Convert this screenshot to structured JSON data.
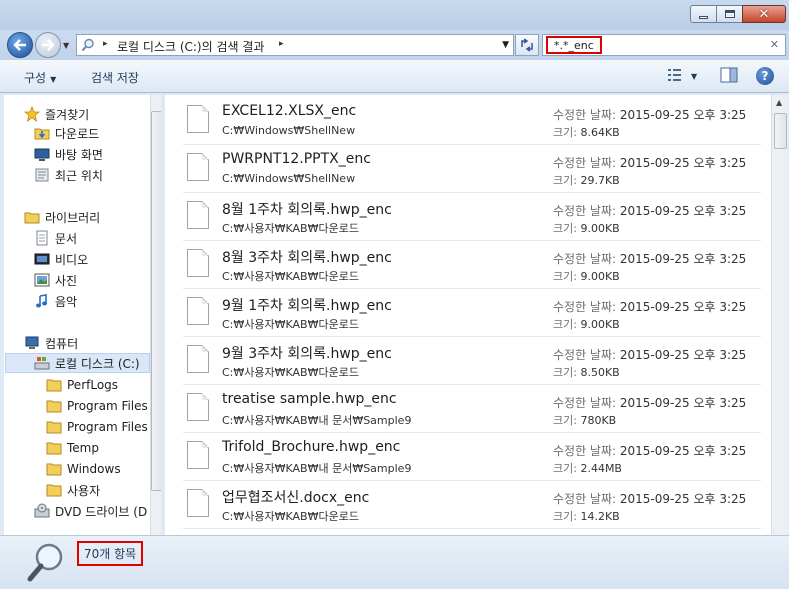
{
  "window": {
    "minimize_label": "minimize",
    "maximize_label": "maximize",
    "close_glyph": "✕"
  },
  "address_bar": {
    "breadcrumb_root_arrow": "▸",
    "location": "로컬 디스크 (C:)의 검색 결과",
    "trailing_arrow": "▸"
  },
  "search": {
    "query": "*.*_enc",
    "clear_glyph": "✕"
  },
  "toolbar": {
    "organize_label": "구성",
    "save_search_label": "검색 저장"
  },
  "nav": {
    "favorites": {
      "label": "즐겨찾기",
      "items": [
        {
          "label": "다운로드",
          "icon": "downloads-icon"
        },
        {
          "label": "바탕 화면",
          "icon": "desktop-icon"
        },
        {
          "label": "최근 위치",
          "icon": "recent-places-icon"
        }
      ]
    },
    "libraries": {
      "label": "라이브러리",
      "items": [
        {
          "label": "문서",
          "icon": "documents-icon"
        },
        {
          "label": "비디오",
          "icon": "videos-icon"
        },
        {
          "label": "사진",
          "icon": "pictures-icon"
        },
        {
          "label": "음악",
          "icon": "music-icon"
        }
      ]
    },
    "computer": {
      "label": "컴퓨터",
      "drive_c": "로컬 디스크 (C:)",
      "folders": [
        "PerfLogs",
        "Program Files",
        "Program Files (",
        "Temp",
        "Windows",
        "사용자"
      ],
      "dvd": "DVD 드라이브 (D"
    }
  },
  "results": {
    "date_label": "수정한 날짜:",
    "size_label": "크기:",
    "items": [
      {
        "name": "EXCEL12.XLSX_enc",
        "path": "C:₩Windows₩ShellNew",
        "modified": "2015-09-25 오후 3:25",
        "size": "8.64KB"
      },
      {
        "name": "PWRPNT12.PPTX_enc",
        "path": "C:₩Windows₩ShellNew",
        "modified": "2015-09-25 오후 3:25",
        "size": "29.7KB"
      },
      {
        "name": "8월 1주차 회의록.hwp_enc",
        "path": "C:₩사용자₩KAB₩다운로드",
        "modified": "2015-09-25 오후 3:25",
        "size": "9.00KB"
      },
      {
        "name": "8월 3주차 회의록.hwp_enc",
        "path": "C:₩사용자₩KAB₩다운로드",
        "modified": "2015-09-25 오후 3:25",
        "size": "9.00KB"
      },
      {
        "name": "9월 1주차 회의록.hwp_enc",
        "path": "C:₩사용자₩KAB₩다운로드",
        "modified": "2015-09-25 오후 3:25",
        "size": "9.00KB"
      },
      {
        "name": "9월 3주차 회의록.hwp_enc",
        "path": "C:₩사용자₩KAB₩다운로드",
        "modified": "2015-09-25 오후 3:25",
        "size": "8.50KB"
      },
      {
        "name": "treatise sample.hwp_enc",
        "path": "C:₩사용자₩KAB₩내 문서₩Sample9",
        "modified": "2015-09-25 오후 3:25",
        "size": "780KB"
      },
      {
        "name": "Trifold_Brochure.hwp_enc",
        "path": "C:₩사용자₩KAB₩내 문서₩Sample9",
        "modified": "2015-09-25 오후 3:25",
        "size": "2.44MB"
      },
      {
        "name": "업무협조서신.docx_enc",
        "path": "C:₩사용자₩KAB₩다운로드",
        "modified": "2015-09-25 오후 3:25",
        "size": "14.2KB"
      }
    ]
  },
  "status": {
    "item_count": "70개 항목"
  },
  "colors": {
    "highlight_box": "#e00000",
    "selection": "#d9e7f8",
    "chrome": "#dfe9f5"
  }
}
